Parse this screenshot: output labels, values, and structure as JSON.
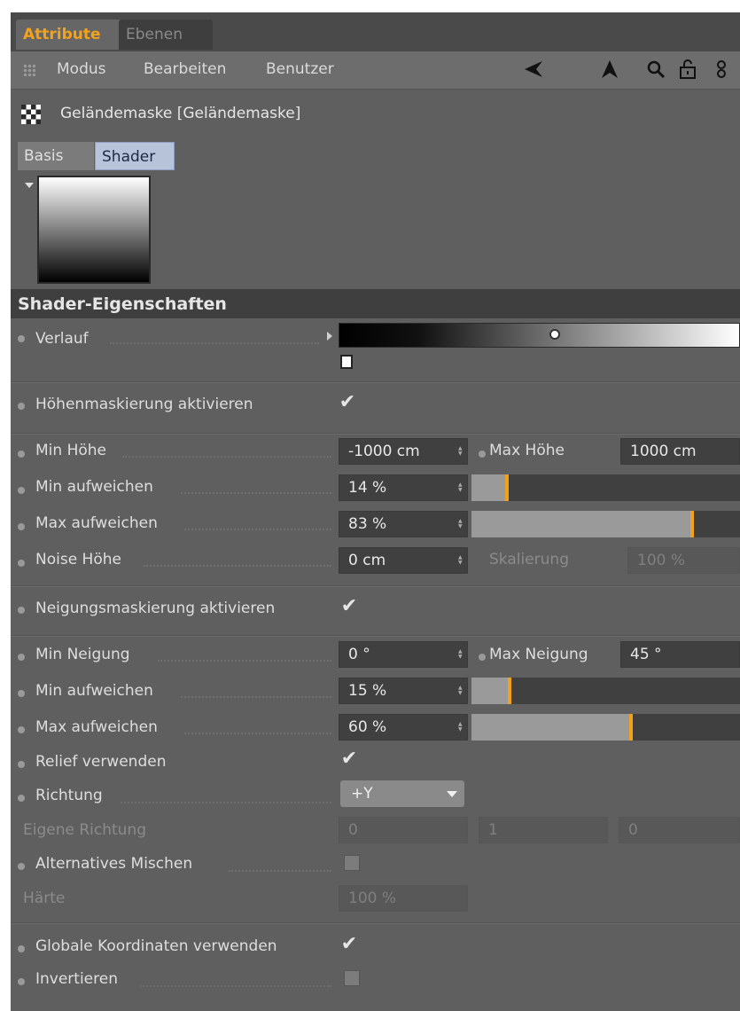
{
  "tabs": {
    "attribute": "Attribute",
    "ebenen": "Ebenen"
  },
  "menu": {
    "modus": "Modus",
    "bearbeiten": "Bearbeiten",
    "benutzer": "Benutzer"
  },
  "header": {
    "title": "Geländemaske [Geländemaske]"
  },
  "subtabs": {
    "basis": "Basis",
    "shader": "Shader"
  },
  "section": {
    "title": "Shader-Eigenschaften"
  },
  "verlauf": {
    "label": "Verlauf"
  },
  "hoehe": {
    "activate_label": "Höhenmaskierung aktivieren",
    "activate_checked": true,
    "min_label": "Min Höhe",
    "min_value": "-1000 cm",
    "max_label": "Max Höhe",
    "max_value": "1000 cm",
    "min_soft_label": "Min aufweichen",
    "min_soft_value": "14 %",
    "min_soft_fraction": 0.14,
    "max_soft_label": "Max aufweichen",
    "max_soft_value": "83 %",
    "max_soft_fraction": 0.83,
    "noise_label": "Noise Höhe",
    "noise_value": "0 cm",
    "scale_label": "Skalierung",
    "scale_value": "100 %"
  },
  "neigung": {
    "activate_label": "Neigungsmaskierung aktivieren",
    "activate_checked": true,
    "min_label": "Min Neigung",
    "min_value": "0 °",
    "max_label": "Max Neigung",
    "max_value": "45 °",
    "min_soft_label": "Min aufweichen",
    "min_soft_value": "15 %",
    "min_soft_fraction": 0.15,
    "max_soft_label": "Max aufweichen",
    "max_soft_value": "60 %",
    "max_soft_fraction": 0.6,
    "relief_label": "Relief verwenden",
    "relief_checked": true,
    "richtung_label": "Richtung",
    "richtung_value": "+Y",
    "eigene_label": "Eigene Richtung",
    "eigene_x": "0",
    "eigene_y": "1",
    "eigene_z": "0",
    "alt_label": "Alternatives Mischen",
    "alt_checked": false,
    "haerte_label": "Härte",
    "haerte_value": "100 %"
  },
  "global": {
    "coords_label": "Globale Koordinaten verwenden",
    "coords_checked": true,
    "invert_label": "Invertieren",
    "invert_checked": false
  },
  "colors": {
    "accent": "#f2a11b",
    "panel": "#5f5f5f",
    "field": "#404040"
  }
}
